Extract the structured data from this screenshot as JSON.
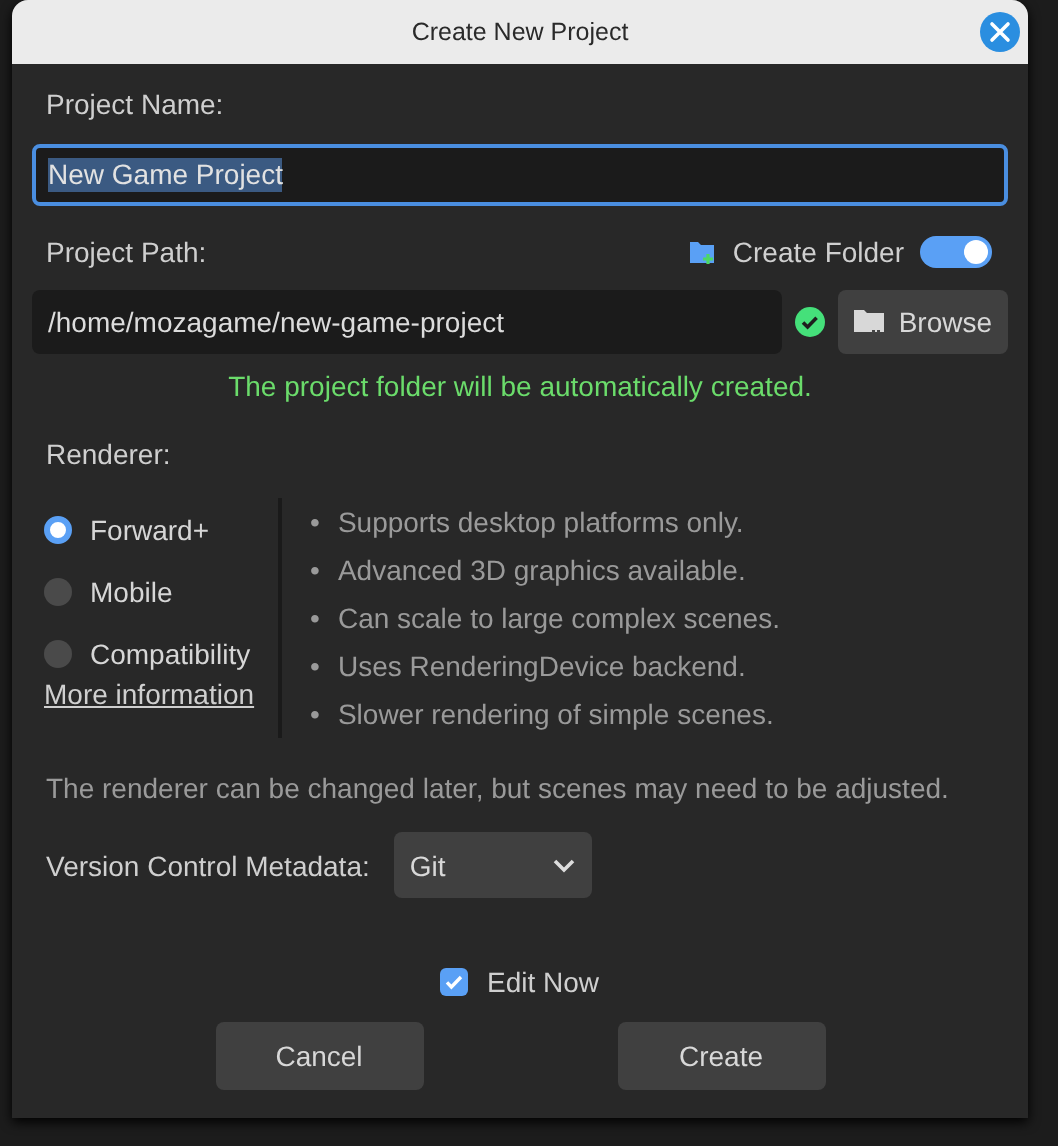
{
  "window": {
    "title": "Create New Project"
  },
  "project_name": {
    "label": "Project Name:",
    "value": "New Game Project",
    "text_selected": true
  },
  "project_path": {
    "label": "Project Path:",
    "value": "/home/mozagame/new-game-project",
    "valid": true,
    "browse_label": "Browse"
  },
  "create_folder": {
    "label": "Create Folder",
    "on": true
  },
  "path_message": "The project folder will be automatically created.",
  "renderer": {
    "label": "Renderer:",
    "options": [
      {
        "label": "Forward+",
        "selected": true
      },
      {
        "label": "Mobile",
        "selected": false
      },
      {
        "label": "Compatibility",
        "selected": false
      }
    ],
    "link": "More information",
    "features": [
      {
        "marker": "•",
        "text": "Supports desktop platforms only."
      },
      {
        "marker": "•",
        "text": "Advanced 3D graphics available."
      },
      {
        "marker": "•",
        "text": "Can scale to large complex scenes."
      },
      {
        "marker": "•",
        "text": "Uses RenderingDevice backend."
      },
      {
        "marker": "•",
        "text": "Slower rendering of simple scenes."
      }
    ],
    "note": "The renderer can be changed later, but scenes may need to be adjusted."
  },
  "version_control": {
    "label": "Version Control Metadata:",
    "value": "Git"
  },
  "edit_now": {
    "label": "Edit Now",
    "checked": true
  },
  "buttons": [
    "Cancel",
    "Create"
  ]
}
